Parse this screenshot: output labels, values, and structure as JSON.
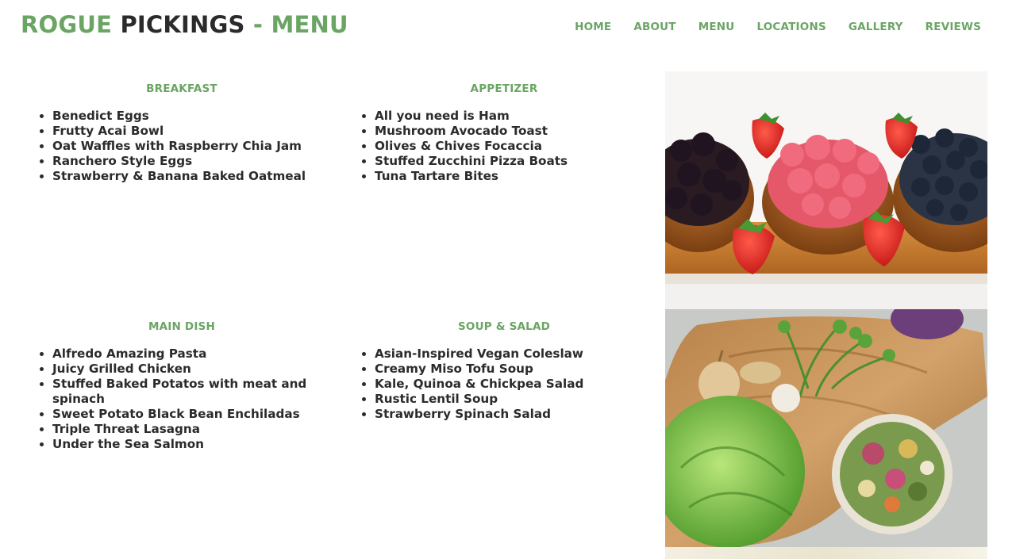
{
  "header": {
    "logo_part1": "ROGUE",
    "logo_part2": "PICKINGS",
    "logo_part3": "- MENU"
  },
  "nav": {
    "items": [
      "HOME",
      "ABOUT",
      "MENU",
      "LOCATIONS",
      "GALLERY",
      "REVIEWS"
    ]
  },
  "menu": {
    "breakfast": {
      "title": "BREAKFAST",
      "items": [
        "Benedict Eggs",
        "Frutty Acai Bowl",
        "Oat Waffles with Raspberry Chia Jam",
        "Ranchero Style Eggs",
        "Strawberry & Banana Baked Oatmeal"
      ]
    },
    "appetizer": {
      "title": "APPETIZER",
      "items": [
        "All you need is Ham",
        "Mushroom Avocado Toast",
        "Olives & Chives Focaccia",
        "Stuffed Zucchini Pizza Boats",
        "Tuna Tartare Bites"
      ]
    },
    "main_dish": {
      "title": "MAIN DISH",
      "items": [
        "Alfredo Amazing Pasta",
        "Juicy Grilled Chicken",
        "Stuffed Baked Potatos with meat and spinach",
        "Sweet Potato Black Bean Enchiladas",
        "Triple Threat Lasagna",
        "Under the Sea Salmon"
      ]
    },
    "soup_salad": {
      "title": "SOUP & SALAD",
      "items": [
        "Asian-Inspired Vegan Coleslaw",
        "Creamy Miso Tofu Soup",
        "Kale, Quinoa & Chickpea Salad",
        "Rustic Lentil Soup",
        "Strawberry Spinach Salad"
      ]
    }
  },
  "colors": {
    "accent": "#6aa564",
    "text": "#2b2b2b",
    "background": "#ffffff"
  }
}
